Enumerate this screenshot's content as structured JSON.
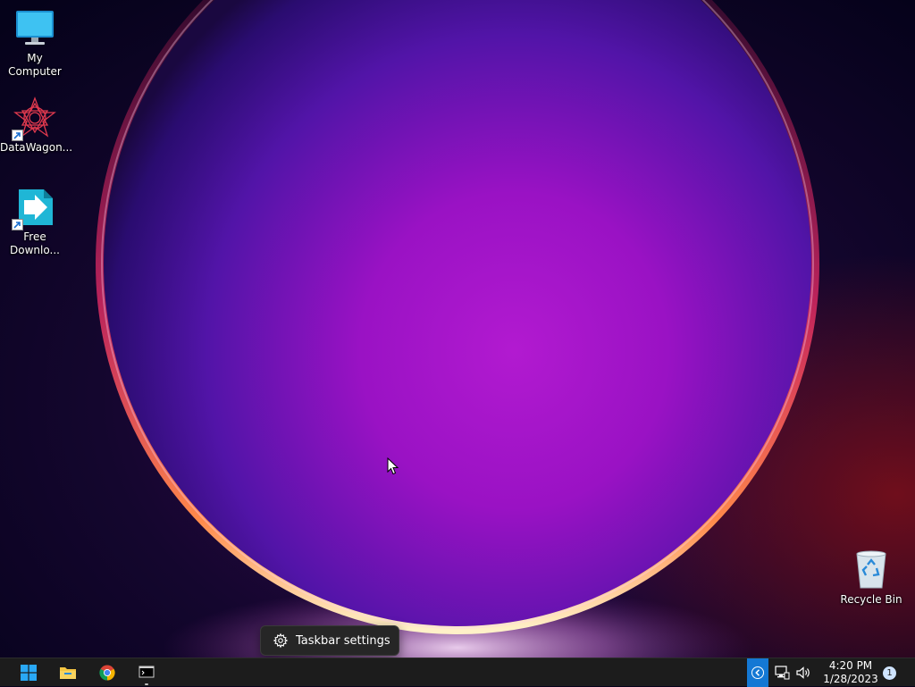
{
  "desktop": {
    "icons": [
      {
        "label": "My Computer",
        "icon": "monitor-icon"
      },
      {
        "label": "DataWagon...",
        "icon": "datawagon-icon"
      },
      {
        "label": "Free\nDownlo...",
        "icon": "free-download-manager-icon"
      },
      {
        "label": "Recycle Bin",
        "icon": "recycle-bin-icon"
      }
    ]
  },
  "context_tip": {
    "label": "Taskbar settings",
    "icon": "gear-icon"
  },
  "taskbar": {
    "pinned": [
      {
        "name": "start",
        "icon": "windows-logo-icon"
      },
      {
        "name": "file-explorer",
        "icon": "folder-icon"
      },
      {
        "name": "chrome",
        "icon": "chrome-icon"
      },
      {
        "name": "terminal",
        "icon": "terminal-icon"
      }
    ],
    "tray": {
      "chevron_icon": "chevron-left-icon",
      "network_icon": "network-icon",
      "volume_icon": "volume-icon",
      "time": "4:20 PM",
      "date": "1/28/2023",
      "notification_count": "1"
    },
    "accent_color": "#1478d4"
  }
}
